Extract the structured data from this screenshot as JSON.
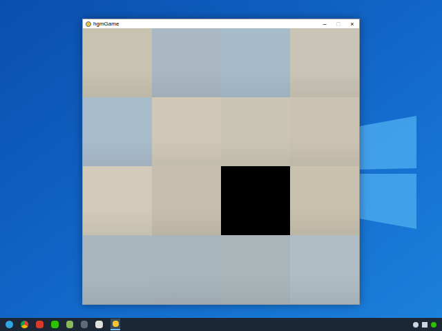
{
  "window": {
    "title": "hgmGame",
    "controls": [
      "–",
      "□",
      "×"
    ]
  },
  "tiles": [
    {
      "kind": "photo",
      "color": "#c8c2b0"
    },
    {
      "kind": "photo",
      "color": "#aab8c3"
    },
    {
      "kind": "photo",
      "color": "#a6bccb"
    },
    {
      "kind": "photo",
      "color": "#c9c4b5"
    },
    {
      "kind": "photo",
      "color": "#a9bccb"
    },
    {
      "kind": "photo",
      "color": "#cfc8b6"
    },
    {
      "kind": "photo",
      "color": "#cbc5b4"
    },
    {
      "kind": "photo",
      "color": "#cac3b2"
    },
    {
      "kind": "photo",
      "color": "#d2cbb9"
    },
    {
      "kind": "photo",
      "color": "#c6bfad"
    },
    {
      "kind": "empty",
      "color": "#000000"
    },
    {
      "kind": "photo",
      "color": "#c8c1ae"
    },
    {
      "kind": "photo",
      "color": "#a9b6bd"
    },
    {
      "kind": "photo",
      "color": "#a8b5bb"
    },
    {
      "kind": "photo",
      "color": "#aab5ba"
    },
    {
      "kind": "photo",
      "color": "#afbcc3"
    }
  ]
}
